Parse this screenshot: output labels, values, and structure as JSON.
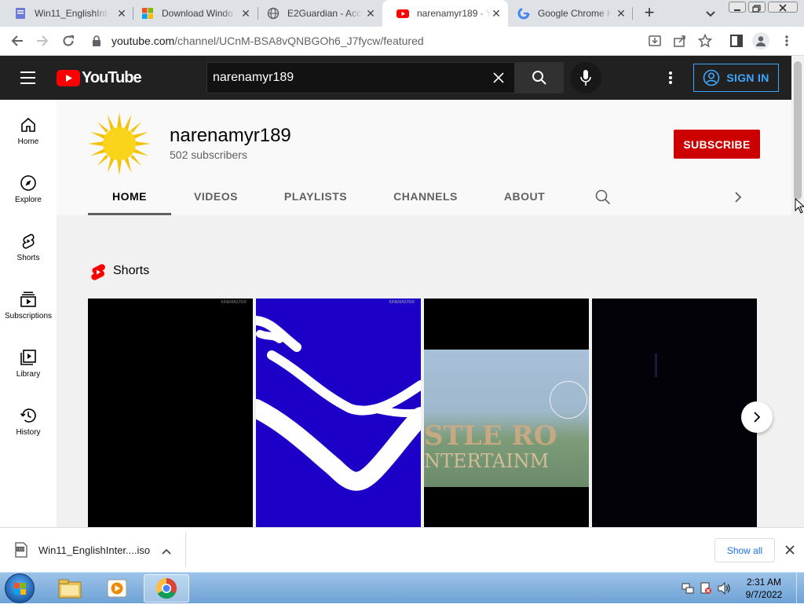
{
  "browser": {
    "tabs": [
      {
        "title": "Win11_EnglishInte",
        "icon": "iso-file-icon"
      },
      {
        "title": "Download Windo",
        "icon": "windows-logo-icon"
      },
      {
        "title": "E2Guardian - Acc",
        "icon": "globe-icon"
      },
      {
        "title": "narenamyr189 - Y",
        "icon": "youtube-icon",
        "active": true
      },
      {
        "title": "Google Chrome H",
        "icon": "google-g-icon"
      }
    ],
    "url_host": "youtube.com",
    "url_path": "/channel/UCnM-BSA8vQNBGOh6_J7fycw/featured"
  },
  "youtube": {
    "logo_text": "YouTube",
    "search_value": "narenamyr189",
    "signin_label": "SIGN IN"
  },
  "guide": [
    {
      "label": "Home",
      "icon": "home-icon"
    },
    {
      "label": "Explore",
      "icon": "compass-icon"
    },
    {
      "label": "Shorts",
      "icon": "shorts-icon"
    },
    {
      "label": "Subscriptions",
      "icon": "subscriptions-icon"
    },
    {
      "label": "Library",
      "icon": "library-icon"
    },
    {
      "label": "History",
      "icon": "history-icon"
    }
  ],
  "channel": {
    "name": "narenamyr189",
    "subscribers": "502 subscribers",
    "subscribe_label": "SUBSCRIBE",
    "tabs": [
      "HOME",
      "VIDEOS",
      "PLAYLISTS",
      "CHANNELS",
      "ABOUT"
    ],
    "active_tab": "HOME"
  },
  "shelf": {
    "title": "Shorts",
    "thumb_labels": [
      "KINEMASTER",
      "KINEMASTER"
    ],
    "thumb3_text": [
      "STLE RO",
      "NTERTAINM"
    ]
  },
  "download": {
    "filename": "Win11_EnglishInter....iso",
    "show_all": "Show all"
  },
  "taskbar": {
    "time": "2:31 AM",
    "date": "9/7/2022"
  },
  "colors": {
    "yt_red": "#ff0000",
    "subscribe_red": "#cc0000",
    "signin_blue": "#3ea6ff",
    "masthead": "#212121"
  }
}
